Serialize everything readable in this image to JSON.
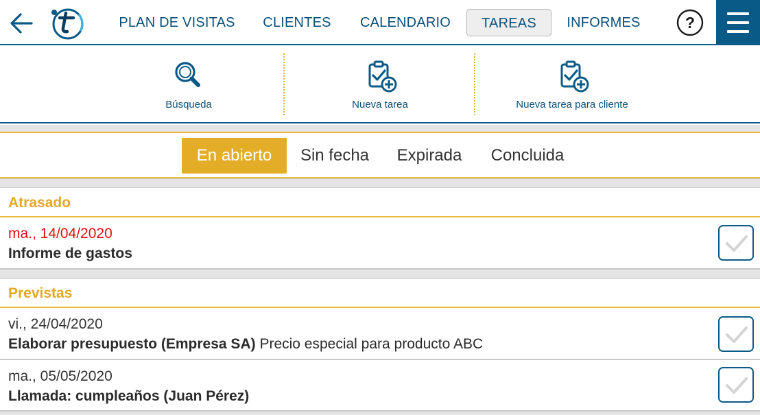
{
  "nav": {
    "back_icon": "arrow-left-icon",
    "logo_icon": "t-logo-icon",
    "items": [
      {
        "label": "PLAN DE VISITAS",
        "active": false
      },
      {
        "label": "CLIENTES",
        "active": false
      },
      {
        "label": "CALENDARIO",
        "active": false
      },
      {
        "label": "TAREAS",
        "active": true
      },
      {
        "label": "INFORMES",
        "active": false
      }
    ],
    "help_label": "?",
    "menu_icon": "hamburger-menu-icon"
  },
  "actions": [
    {
      "label": "Búsqueda",
      "icon": "search-icon"
    },
    {
      "label": "Nueva tarea",
      "icon": "clipboard-add-icon"
    },
    {
      "label": "Nueva tarea para cliente",
      "icon": "clipboard-add-icon"
    }
  ],
  "tabs": [
    {
      "label": "En abierto",
      "active": true
    },
    {
      "label": "Sin fecha",
      "active": false
    },
    {
      "label": "Expirada",
      "active": false
    },
    {
      "label": "Concluida",
      "active": false
    }
  ],
  "sections": [
    {
      "title": "Atrasado",
      "tasks": [
        {
          "date": "ma., 14/04/2020",
          "overdue": true,
          "title_bold": "Informe de gastos",
          "title_rest": ""
        }
      ]
    },
    {
      "title": "Previstas",
      "tasks": [
        {
          "date": "vi., 24/04/2020",
          "overdue": false,
          "title_bold": "Elaborar presupuesto (Empresa SA)",
          "title_rest": " Precio especial para producto ABC"
        },
        {
          "date": "ma., 05/05/2020",
          "overdue": false,
          "title_bold": "Llamada: cumpleaños (Juan Pérez)",
          "title_rest": ""
        }
      ]
    }
  ],
  "colors": {
    "brand_blue": "#0a5a87",
    "accent_yellow": "#e3ad27",
    "overdue_red": "#e01010"
  }
}
